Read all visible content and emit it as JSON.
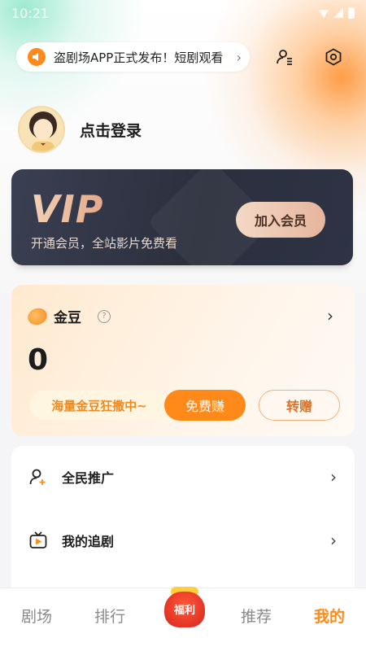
{
  "status_bar": {
    "time": "10:21"
  },
  "notice": {
    "text": "盗剧场APP正式发布！短剧观看"
  },
  "profile": {
    "login_label": "点击登录"
  },
  "vip_card": {
    "logo": "VIP",
    "subtitle": "开通会员，全站影片免费看",
    "join_button": "加入会员"
  },
  "coin_card": {
    "title": "金豆",
    "help_icon": "?",
    "value": "0",
    "promo": "海量金豆狂撒中~",
    "earn_button": "免费赚",
    "gift_button": "转赠"
  },
  "menu": {
    "items": [
      {
        "label": "全民推广",
        "icon": "user-add-icon"
      },
      {
        "label": "我的追剧",
        "icon": "tv-icon"
      }
    ]
  },
  "tab_bar": {
    "tabs": [
      "剧场",
      "排行",
      "福利",
      "推荐",
      "我的"
    ],
    "active": "我的"
  },
  "colors": {
    "accent": "#ff8a1a",
    "vip_bg": "#2b2f3d",
    "vip_gold": "#e6b49c"
  }
}
